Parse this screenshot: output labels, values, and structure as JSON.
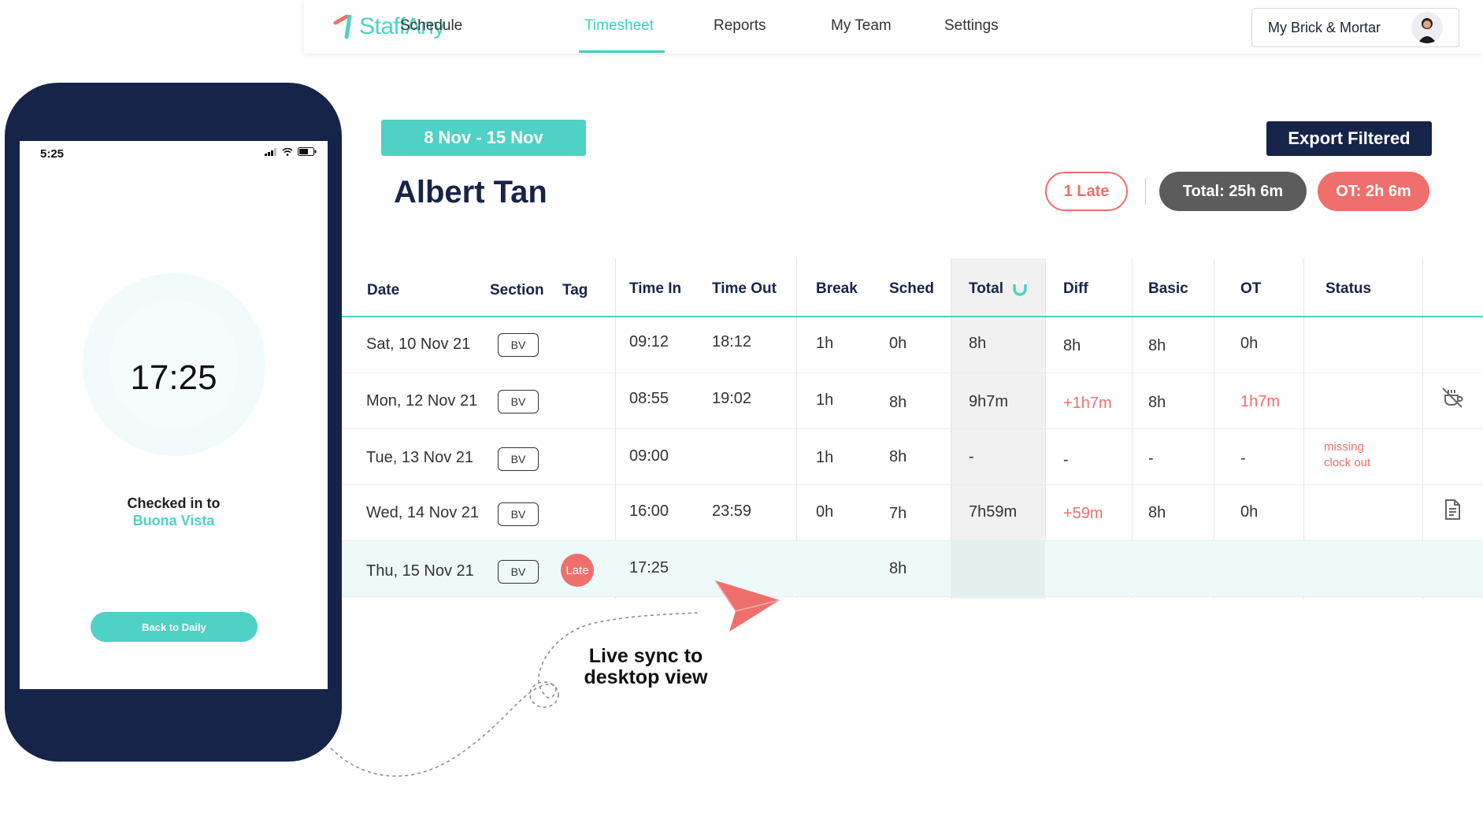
{
  "nav": {
    "brand": "StaffAny",
    "items": [
      {
        "label": "Schedule"
      },
      {
        "label": "Timesheet",
        "active": true
      },
      {
        "label": "Reports"
      },
      {
        "label": "My Team"
      },
      {
        "label": "Settings"
      }
    ],
    "store_label": "My Brick & Mortar",
    "accent": "#3ecfc0"
  },
  "phone": {
    "status_time": "5:25",
    "clock_time": "17:25",
    "checked_label": "Checked in to",
    "checked_location": "Buona Vista",
    "back_button": "Back to Daily"
  },
  "header": {
    "date_range": "8 Nov - 15 Nov",
    "employee_name": "Albert Tan",
    "export_button": "Export Filtered",
    "late_pill": "1 Late",
    "total_pill": "Total: 25h 6m",
    "ot_pill": "OT: 2h 6m"
  },
  "table": {
    "headers": {
      "date": "Date",
      "section": "Section",
      "tag": "Tag",
      "time_in": "Time In",
      "time_out": "Time Out",
      "break": "Break",
      "sched": "Sched",
      "total": "Total",
      "diff": "Diff",
      "basic": "Basic",
      "ot": "OT",
      "status": "Status"
    },
    "rows": [
      {
        "date": "Sat, 10 Nov 21",
        "section": "BV",
        "tag": "",
        "time_in": "09:12",
        "time_out": "18:12",
        "break": "1h",
        "sched": "0h",
        "total": "8h",
        "diff": "8h",
        "basic": "8h",
        "ot": "0h",
        "status": ""
      },
      {
        "date": "Mon, 12 Nov 21",
        "section": "BV",
        "tag": "",
        "time_in": "08:55",
        "time_out": "19:02",
        "break": "1h",
        "sched": "8h",
        "total": "9h7m",
        "diff": "+1h7m",
        "basic": "8h",
        "ot": "1h7m",
        "status": ""
      },
      {
        "date": "Tue, 13 Nov 21",
        "section": "BV",
        "tag": "",
        "time_in": "09:00",
        "time_out": "",
        "break": "1h",
        "sched": "8h",
        "total": "-",
        "diff": "-",
        "basic": "-",
        "ot": "-",
        "status_line1": "missing",
        "status_line2": "clock out"
      },
      {
        "date": "Wed, 14 Nov 21",
        "section": "BV",
        "tag": "",
        "time_in": "16:00",
        "time_out": "23:59",
        "break": "0h",
        "sched": "7h",
        "total": "7h59m",
        "diff": "+59m",
        "basic": "8h",
        "ot": "0h",
        "status": ""
      },
      {
        "date": "Thu, 15 Nov 21",
        "section": "BV",
        "tag": "Late",
        "time_in": "17:25",
        "time_out": "",
        "break": "",
        "sched": "8h",
        "total": "",
        "diff": "",
        "basic": "",
        "ot": "",
        "status": ""
      }
    ]
  },
  "annotation": {
    "line1": "Live sync to",
    "line2": "desktop view"
  },
  "colors": {
    "teal": "#4fd1c5",
    "navy": "#17244a",
    "coral": "#ef6f6c",
    "grey_pill": "#5c5c5c"
  }
}
